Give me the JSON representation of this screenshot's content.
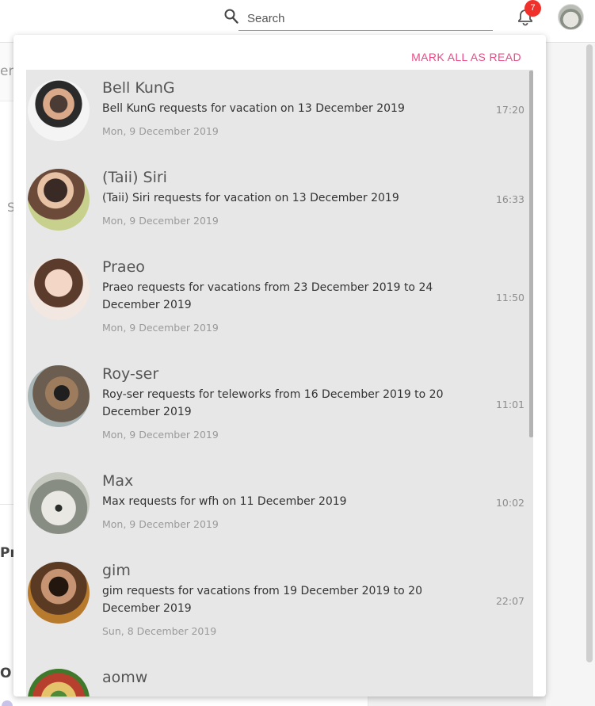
{
  "search": {
    "placeholder": "Search",
    "icon": "search-icon"
  },
  "header": {
    "notification_count": "7",
    "bell_icon": "bell-icon"
  },
  "background_fragments": {
    "f1": "er",
    "f2": "S",
    "f3": "Pr",
    "f4": "O"
  },
  "notifications": {
    "mark_all_read": "MARK ALL AS READ",
    "accent_color": "#e74c86",
    "items": [
      {
        "name": "Bell KunG",
        "message": "Bell KunG requests for vacation on 13 December 2019",
        "date": "Mon, 9 December 2019",
        "time": "17:20"
      },
      {
        "name": "(Taii) Siri",
        "message": "(Taii) Siri requests for vacation on 13 December 2019",
        "date": "Mon, 9 December 2019",
        "time": "16:33"
      },
      {
        "name": "Praeo",
        "message": "Praeo requests for vacations from 23 December 2019 to 24 December 2019",
        "date": "Mon, 9 December 2019",
        "time": "11:50"
      },
      {
        "name": "Roy-ser",
        "message": "Roy-ser requests for teleworks from 16 December 2019 to 20 December 2019",
        "date": "Mon, 9 December 2019",
        "time": "11:01"
      },
      {
        "name": "Max",
        "message": "Max requests for wfh on 11 December 2019",
        "date": "Mon, 9 December 2019",
        "time": "10:02"
      },
      {
        "name": "gim",
        "message": "gim requests for vacations from 19 December 2019 to 20 December 2019",
        "date": "Sun, 8 December 2019",
        "time": "22:07"
      },
      {
        "name": "aomw"
      }
    ]
  }
}
